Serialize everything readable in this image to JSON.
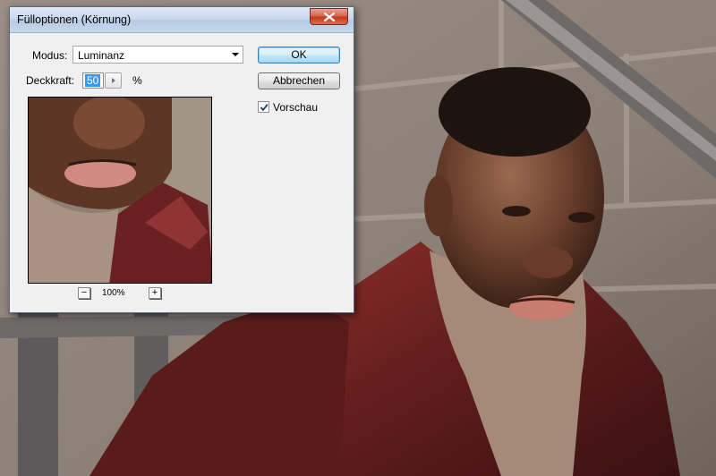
{
  "dialog": {
    "title": "Fülloptionen (Körnung)",
    "mode_label": "Modus:",
    "mode_value": "Luminanz",
    "opacity_label": "Deckkraft:",
    "opacity_value": "50",
    "opacity_unit": "%",
    "ok_label": "OK",
    "cancel_label": "Abbrechen",
    "preview_label": "Vorschau",
    "preview_checked": true,
    "zoom_minus": "−",
    "zoom_plus": "+",
    "zoom_level": "100%"
  },
  "icons": {
    "close": "close-icon",
    "dropdown": "chevron-down-icon",
    "stepper": "triangle-right-icon",
    "check": "checkmark-icon"
  },
  "colors": {
    "titlebar": "#c9d9ec",
    "close_button": "#c3391f",
    "default_button_border": "#3c7fb1",
    "selection": "#3399ff",
    "dialog_face": "#f0f0f0"
  }
}
